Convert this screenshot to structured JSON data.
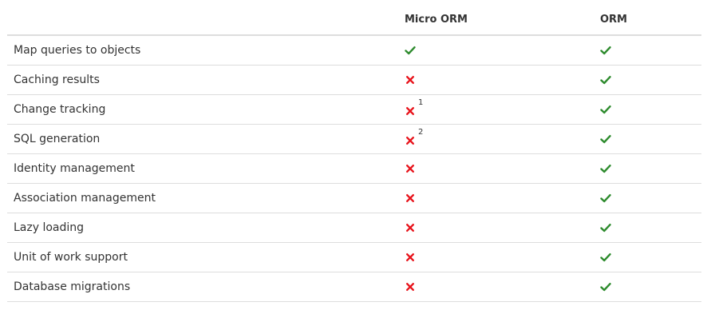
{
  "table": {
    "headers": {
      "feature": "",
      "micro_orm": "Micro ORM",
      "orm": "ORM"
    },
    "rows": [
      {
        "feature": "Map queries to objects",
        "micro_orm": "yes",
        "micro_orm_note": "",
        "orm": "yes"
      },
      {
        "feature": "Caching results",
        "micro_orm": "no",
        "micro_orm_note": "",
        "orm": "yes"
      },
      {
        "feature": "Change tracking",
        "micro_orm": "no",
        "micro_orm_note": "1",
        "orm": "yes"
      },
      {
        "feature": "SQL generation",
        "micro_orm": "no",
        "micro_orm_note": "2",
        "orm": "yes"
      },
      {
        "feature": "Identity management",
        "micro_orm": "no",
        "micro_orm_note": "",
        "orm": "yes"
      },
      {
        "feature": "Association management",
        "micro_orm": "no",
        "micro_orm_note": "",
        "orm": "yes"
      },
      {
        "feature": "Lazy loading",
        "micro_orm": "no",
        "micro_orm_note": "",
        "orm": "yes"
      },
      {
        "feature": "Unit of work support",
        "micro_orm": "no",
        "micro_orm_note": "",
        "orm": "yes"
      },
      {
        "feature": "Database migrations",
        "micro_orm": "no",
        "micro_orm_note": "",
        "orm": "yes"
      }
    ]
  },
  "colors": {
    "check": "#2e8b2e",
    "cross": "#e8141c",
    "border": "#dddddd",
    "text": "#333333"
  },
  "icons": {
    "yes": "check-icon",
    "no": "cross-icon"
  }
}
